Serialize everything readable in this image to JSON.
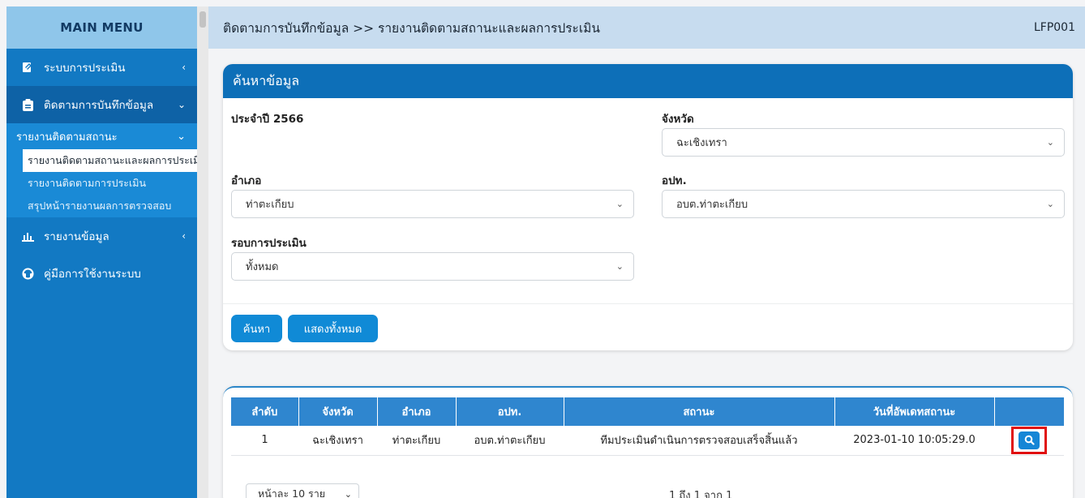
{
  "sidebar": {
    "title": "MAIN MENU",
    "items": [
      {
        "label": "ระบบการประเมิน",
        "icon": "document-edit-icon",
        "chevron": "‹"
      },
      {
        "label": "ติดตามการบันทึกข้อมูล",
        "icon": "clipboard-icon",
        "chevron": "⌄"
      },
      {
        "label": "รายงานข้อมูล",
        "icon": "bar-chart-icon",
        "chevron": "‹"
      },
      {
        "label": "คู่มือการใช้งานระบบ",
        "icon": "headset-icon"
      }
    ],
    "submenu": {
      "label": "รายงานติดตามสถานะ",
      "chevron": "⌄",
      "links": [
        "รายงานติดตามสถานะและผลการประเมิน",
        "รายงานติดตามการประเมิน",
        "สรุปหน้ารายงานผลการตรวจสอบ"
      ]
    }
  },
  "header": {
    "breadcrumb": "ติดตามการบันทึกข้อมูล >>  รายงานติดตามสถานะและผลการประเมิน",
    "code": "LFP001"
  },
  "search": {
    "title": "ค้นหาข้อมูล",
    "year_label": "ประจำปี 2566",
    "province_label": "จังหวัด",
    "province_value": "ฉะเชิงเทรา",
    "district_label": "อำเภอ",
    "district_value": "ท่าตะเกียบ",
    "lao_label": "อปท.",
    "lao_value": "อบต.ท่าตะเกียบ",
    "round_label": "รอบการประเมิน",
    "round_value": "ทั้งหมด",
    "search_button": "ค้นหา",
    "show_all_button": "แสดงทั้งหมด"
  },
  "results": {
    "columns": [
      "ลำดับ",
      "จังหวัด",
      "อำเภอ",
      "อปท.",
      "สถานะ",
      "วันที่อัพเดทสถานะ",
      ""
    ],
    "rows": [
      [
        "1",
        "ฉะเชิงเทรา",
        "ท่าตะเกียบ",
        "อบต.ท่าตะเกียบ",
        "ทีมประเมินดำเนินการตรวจสอบเสร็จสิ้นแล้ว",
        "2023-01-10 10:05:29.0"
      ]
    ],
    "page_size": "หน้าละ 10 ราย",
    "record_info": "1 ถึง 1 จาก 1"
  },
  "colors": {
    "sidebar": "#1279c3",
    "header": "#c7dcef",
    "accent": "#108ad6",
    "highlight": "#e01010"
  }
}
